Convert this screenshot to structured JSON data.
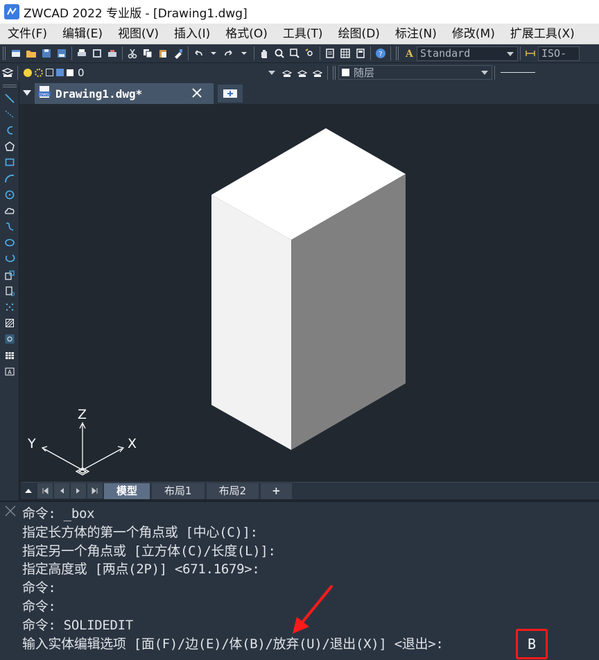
{
  "window": {
    "title": "ZWCAD 2022 专业版 - [Drawing1.dwg]"
  },
  "menu": [
    {
      "label": "文件(F)"
    },
    {
      "label": "编辑(E)"
    },
    {
      "label": "视图(V)"
    },
    {
      "label": "插入(I)"
    },
    {
      "label": "格式(O)"
    },
    {
      "label": "工具(T)"
    },
    {
      "label": "绘图(D)"
    },
    {
      "label": "标注(N)"
    },
    {
      "label": "修改(M)"
    },
    {
      "label": "扩展工具(X)"
    }
  ],
  "toolbar": {
    "text_style": "Standard",
    "dim_style": "ISO-",
    "layer": "0",
    "color": "随层"
  },
  "document_tab": {
    "label": "Drawing1.dwg*"
  },
  "ucs": {
    "z_label": "Z",
    "y_label": "Y",
    "x_label": "X"
  },
  "layout_tabs": [
    {
      "label": "模型",
      "active": true
    },
    {
      "label": "布局1",
      "active": false
    },
    {
      "label": "布局2",
      "active": false
    },
    {
      "label": "+",
      "active": false
    }
  ],
  "command_window": {
    "lines": [
      "命令: _box",
      "指定长方体的第一个角点或 [中心(C)]:",
      "指定另一个角点或 [立方体(C)/长度(L)]:",
      "指定高度或 [两点(2P)] <671.1679>:",
      "命令:",
      "命令:",
      "命令: SOLIDEDIT",
      "输入实体编辑选项 [面(F)/边(E)/体(B)/放弃(U)/退出(X)] <退出>:"
    ],
    "input_value": "B"
  },
  "colors": {
    "background": "#212830",
    "panel": "#2a3441",
    "highlight": "#ff1a1a",
    "box_top": "#ffffff",
    "box_left": "#f2f2f2",
    "box_right": "#808080"
  }
}
